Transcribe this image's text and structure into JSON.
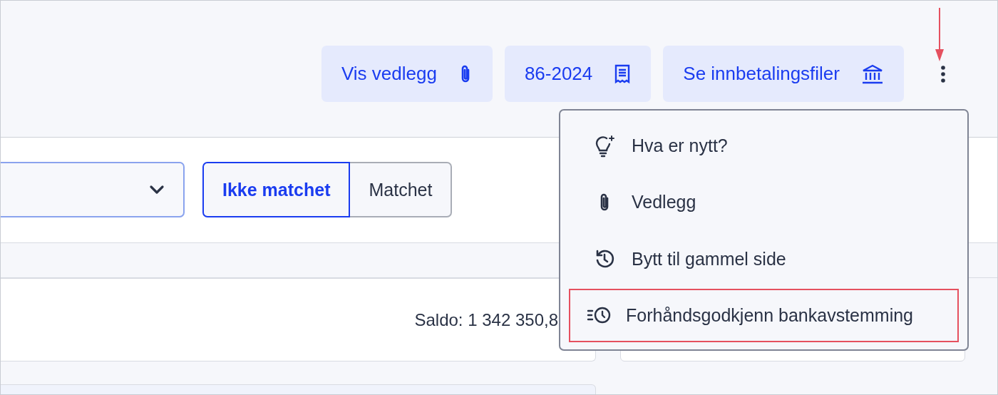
{
  "header": {
    "buttons": [
      {
        "label": "Vis vedlegg",
        "kind": "paperclip"
      },
      {
        "label": "86-2024",
        "kind": "receipt"
      },
      {
        "label": "Se innbetalingsfiler",
        "kind": "bank"
      }
    ],
    "more_menu_open": true
  },
  "filter": {
    "toggle": [
      {
        "label": "Ikke matchet",
        "selected": true
      },
      {
        "label": "Matchet",
        "selected": false
      }
    ]
  },
  "account": {
    "balance": "Saldo: 1 342 350,8"
  },
  "menu": {
    "items": [
      {
        "label": "Hva er nytt?",
        "kind": "bulb",
        "highlighted": false
      },
      {
        "label": "Vedlegg",
        "kind": "paperclip",
        "highlighted": false
      },
      {
        "label": "Bytt til gammel side",
        "kind": "history",
        "highlighted": false
      },
      {
        "label": "Forhåndsgodkjenn bankavstemming",
        "kind": "fast-clock",
        "highlighted": true
      }
    ]
  }
}
